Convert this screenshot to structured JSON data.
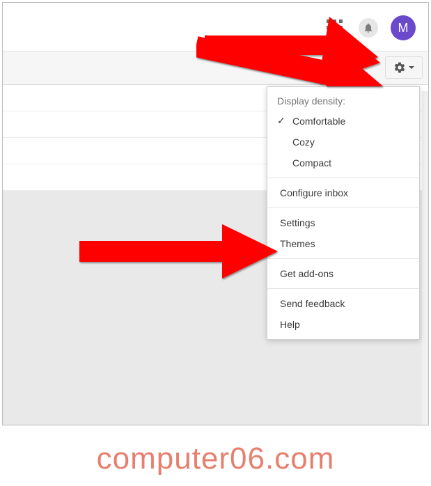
{
  "topbar": {
    "avatar_letter": "M"
  },
  "menu": {
    "heading": "Display density:",
    "density": {
      "comfortable": "Comfortable",
      "cozy": "Cozy",
      "compact": "Compact"
    },
    "configure_inbox": "Configure inbox",
    "settings": "Settings",
    "themes": "Themes",
    "get_addons": "Get add-ons",
    "send_feedback": "Send feedback",
    "help": "Help"
  },
  "watermark": "computer06.com"
}
